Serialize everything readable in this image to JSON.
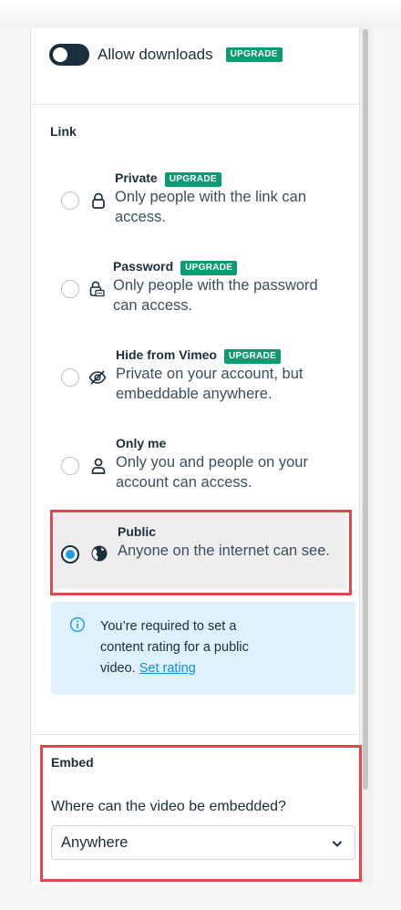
{
  "downloads": {
    "label": "Allow downloads",
    "badge": "UPGRADE",
    "enabled": false
  },
  "link": {
    "title": "Link",
    "options": [
      {
        "title": "Private",
        "badge": "UPGRADE",
        "desc": "Only people with the link can access.",
        "icon": "lock-icon",
        "selected": false
      },
      {
        "title": "Password",
        "badge": "UPGRADE",
        "desc": "Only people with the password can access.",
        "icon": "password-lock-icon",
        "selected": false
      },
      {
        "title": "Hide from Vimeo",
        "badge": "UPGRADE",
        "desc": "Private on your account, but embeddable anywhere.",
        "icon": "eye-slash-icon",
        "selected": false
      },
      {
        "title": "Only me",
        "badge": "",
        "desc": "Only you and people on your account can access.",
        "icon": "person-icon",
        "selected": false
      },
      {
        "title": "Public",
        "badge": "",
        "desc": "Anyone on the internet can see.",
        "icon": "globe-icon",
        "selected": true
      }
    ]
  },
  "notice": {
    "text": "You’re required to set a content rating for a public video.",
    "link": "Set rating"
  },
  "embed": {
    "title": "Embed",
    "question": "Where can the video be embedded?",
    "selected": "Anywhere"
  },
  "colors": {
    "badge": "#0f9b72",
    "radio_selected": "#1b9ef3",
    "highlight": "#e2474b",
    "notice_bg": "#dff1fb"
  }
}
